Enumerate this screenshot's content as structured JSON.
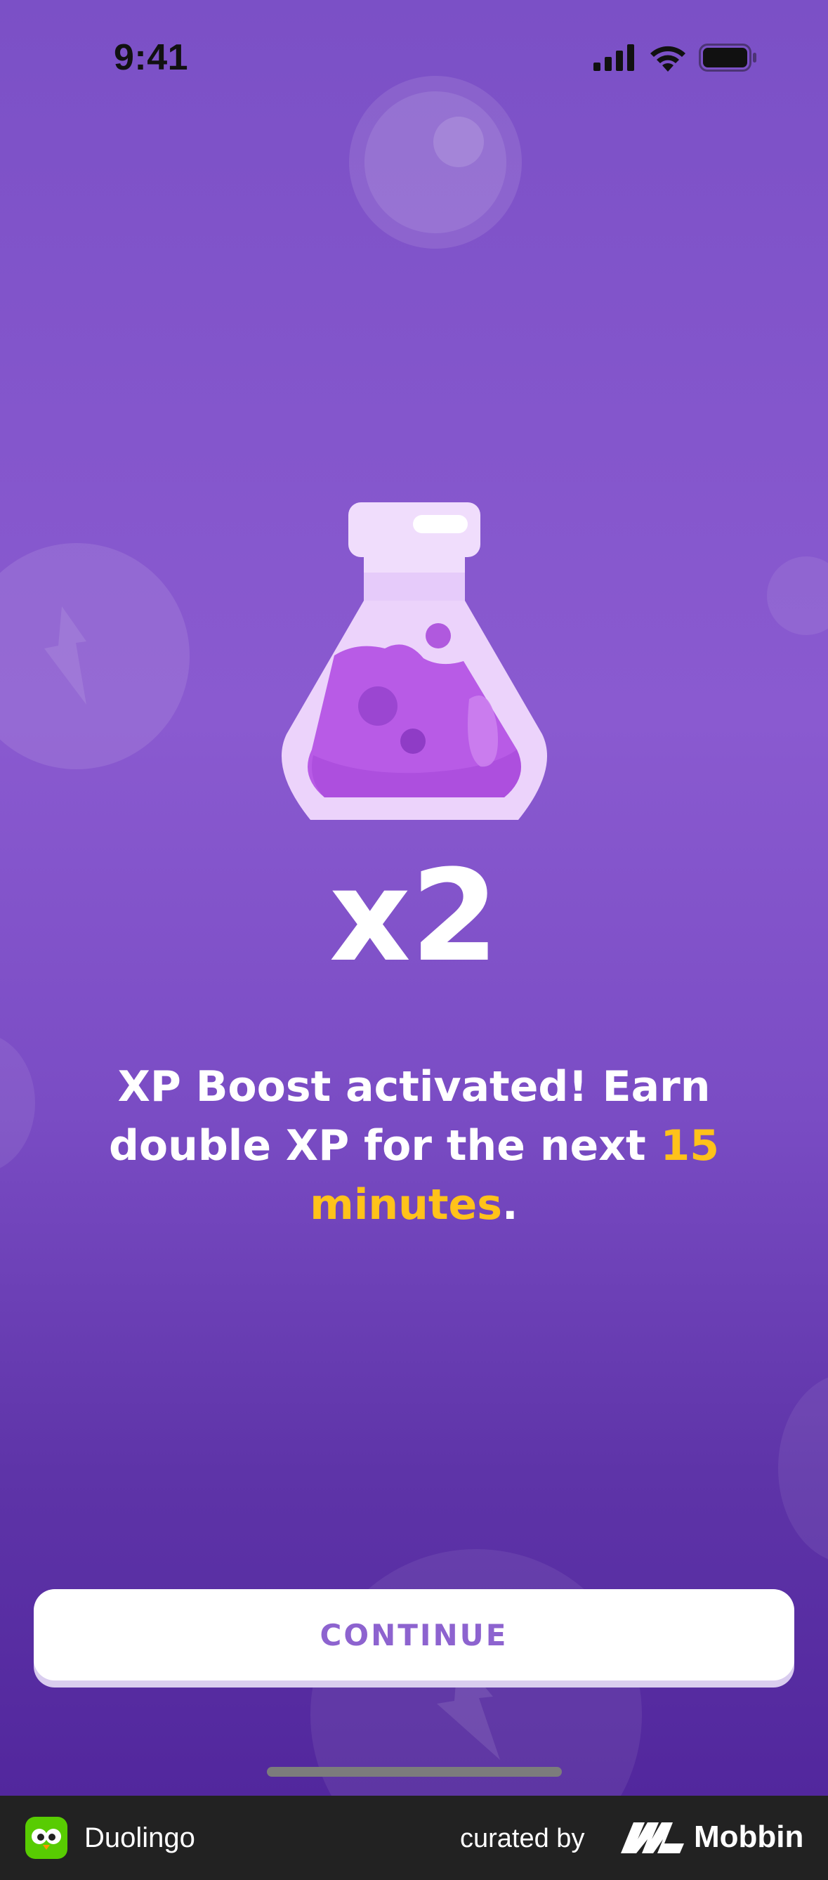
{
  "status_bar": {
    "time": "9:41"
  },
  "boost": {
    "multiplier": "x2",
    "message_before": "XP Boost activated! Earn double XP for the next ",
    "message_highlight": "15 minutes",
    "message_after": ".",
    "highlight_color": "#ffc21a"
  },
  "actions": {
    "continue_label": "CONTINUE"
  },
  "footer": {
    "app_name": "Duolingo",
    "curated_by": "curated by",
    "brand": "Mobbin"
  },
  "icons": {
    "illustration": "potion-flask-icon",
    "signal": "cellular-signal-icon",
    "wifi": "wifi-icon",
    "battery": "battery-icon"
  },
  "colors": {
    "background_top": "#7b50c6",
    "background_bottom": "#52279d",
    "button_text": "#8d63cf"
  }
}
